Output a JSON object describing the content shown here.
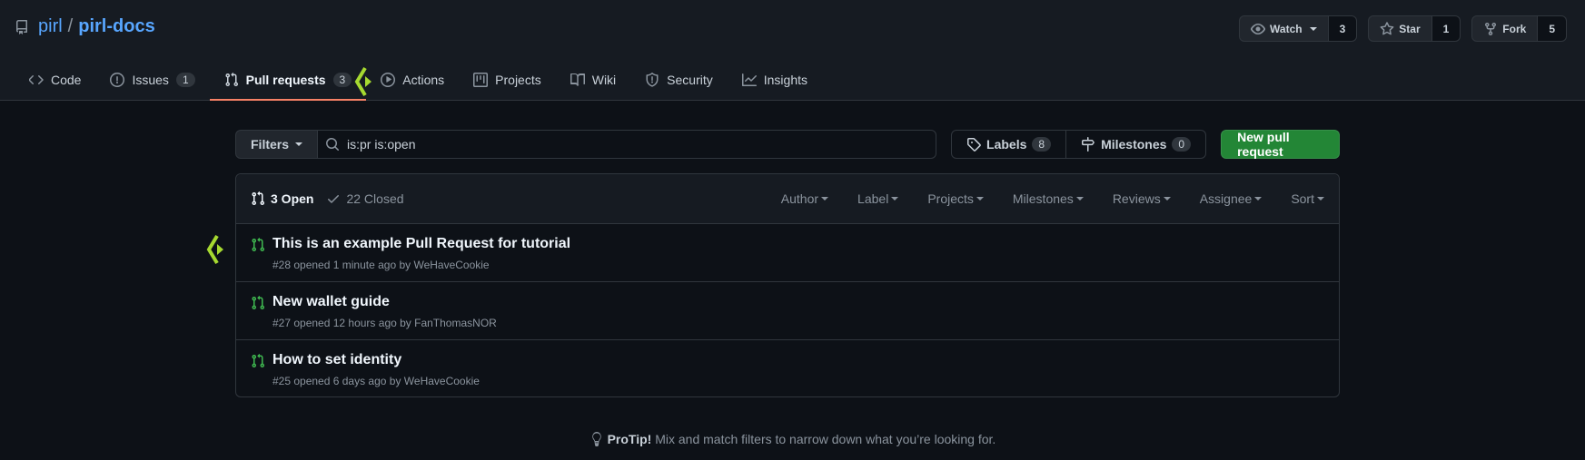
{
  "repo": {
    "owner": "pirl",
    "separator": "/",
    "name": "pirl-docs"
  },
  "actions": {
    "watch": {
      "label": "Watch",
      "count": "3"
    },
    "star": {
      "label": "Star",
      "count": "1"
    },
    "fork": {
      "label": "Fork",
      "count": "5"
    }
  },
  "tabs": [
    {
      "label": "Code",
      "icon": "code-icon"
    },
    {
      "label": "Issues",
      "icon": "issue-icon",
      "counter": "1"
    },
    {
      "label": "Pull requests",
      "icon": "pull-request-icon",
      "counter": "3",
      "selected": true
    },
    {
      "label": "Actions",
      "icon": "play-icon"
    },
    {
      "label": "Projects",
      "icon": "project-icon"
    },
    {
      "label": "Wiki",
      "icon": "book-icon"
    },
    {
      "label": "Security",
      "icon": "shield-icon"
    },
    {
      "label": "Insights",
      "icon": "graph-icon"
    }
  ],
  "subnav": {
    "filters_label": "Filters",
    "search_value": "is:pr is:open",
    "labels_label": "Labels",
    "labels_count": "8",
    "milestones_label": "Milestones",
    "milestones_count": "0",
    "new_pr_label": "New pull request"
  },
  "list": {
    "open_label": "3 Open",
    "closed_label": "22 Closed",
    "sort_menus": [
      "Author",
      "Label",
      "Projects",
      "Milestones",
      "Reviews",
      "Assignee",
      "Sort"
    ],
    "items": [
      {
        "title": "This is an example Pull Request for tutorial",
        "meta": "#28 opened 1 minute ago by WeHaveCookie"
      },
      {
        "title": "New wallet guide",
        "meta": "#27 opened 12 hours ago by FanThomasNOR"
      },
      {
        "title": "How to set identity",
        "meta": "#25 opened 6 days ago by WeHaveCookie"
      }
    ]
  },
  "protip": {
    "label": "ProTip!",
    "text": " Mix and match filters to narrow down what you’re looking for."
  },
  "colors": {
    "accent_green": "#238636",
    "link_blue": "#58a6ff",
    "tab_underline": "#f78166",
    "pr_open_green": "#3fb950",
    "marker_green": "#a6d930"
  }
}
